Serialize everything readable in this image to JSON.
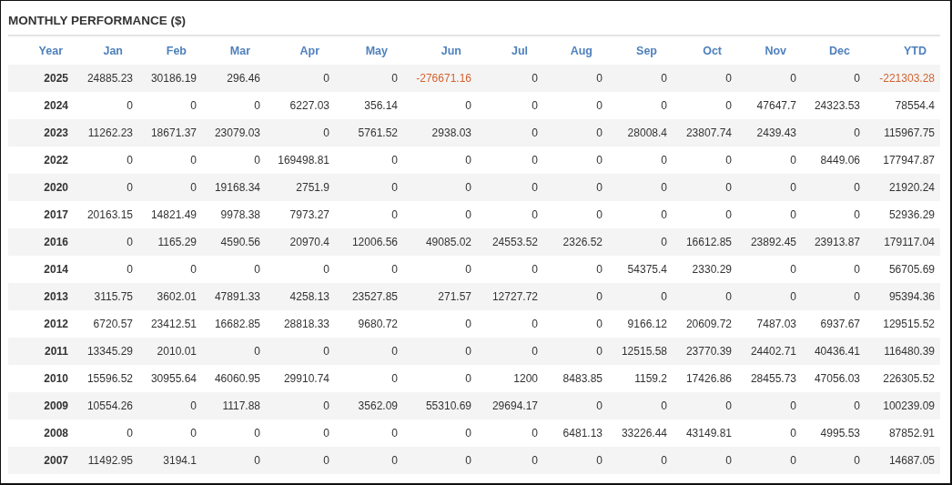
{
  "title": "MONTHLY PERFORMANCE ($)",
  "columns": [
    "Year",
    "Jan",
    "Feb",
    "Mar",
    "Apr",
    "May",
    "Jun",
    "Jul",
    "Aug",
    "Sep",
    "Oct",
    "Nov",
    "Dec",
    "YTD"
  ],
  "rows": [
    {
      "year": "2025",
      "cells": [
        {
          "text": "24885.23",
          "loss": false
        },
        {
          "text": "30186.19",
          "loss": false
        },
        {
          "text": "296.46",
          "loss": false
        },
        {
          "text": "0",
          "loss": false
        },
        {
          "text": "0",
          "loss": false
        },
        {
          "text": "-276671.16",
          "loss": true
        },
        {
          "text": "0",
          "loss": false
        },
        {
          "text": "0",
          "loss": false
        },
        {
          "text": "0",
          "loss": false
        },
        {
          "text": "0",
          "loss": false
        },
        {
          "text": "0",
          "loss": false
        },
        {
          "text": "0",
          "loss": false
        },
        {
          "text": "-221303.28",
          "loss": true
        }
      ]
    },
    {
      "year": "2024",
      "cells": [
        {
          "text": "0",
          "loss": false
        },
        {
          "text": "0",
          "loss": false
        },
        {
          "text": "0",
          "loss": false
        },
        {
          "text": "6227.03",
          "loss": false
        },
        {
          "text": "356.14",
          "loss": false
        },
        {
          "text": "0",
          "loss": false
        },
        {
          "text": "0",
          "loss": false
        },
        {
          "text": "0",
          "loss": false
        },
        {
          "text": "0",
          "loss": false
        },
        {
          "text": "0",
          "loss": false
        },
        {
          "text": "47647.7",
          "loss": false
        },
        {
          "text": "24323.53",
          "loss": false
        },
        {
          "text": "78554.4",
          "loss": false
        }
      ]
    },
    {
      "year": "2023",
      "cells": [
        {
          "text": "11262.23",
          "loss": false
        },
        {
          "text": "18671.37",
          "loss": false
        },
        {
          "text": "23079.03",
          "loss": false
        },
        {
          "text": "0",
          "loss": false
        },
        {
          "text": "5761.52",
          "loss": false
        },
        {
          "text": "2938.03",
          "loss": false
        },
        {
          "text": "0",
          "loss": false
        },
        {
          "text": "0",
          "loss": false
        },
        {
          "text": "28008.4",
          "loss": false
        },
        {
          "text": "23807.74",
          "loss": false
        },
        {
          "text": "2439.43",
          "loss": false
        },
        {
          "text": "0",
          "loss": false
        },
        {
          "text": "115967.75",
          "loss": false
        }
      ]
    },
    {
      "year": "2022",
      "cells": [
        {
          "text": "0",
          "loss": false
        },
        {
          "text": "0",
          "loss": false
        },
        {
          "text": "0",
          "loss": false
        },
        {
          "text": "169498.81",
          "loss": false
        },
        {
          "text": "0",
          "loss": false
        },
        {
          "text": "0",
          "loss": false
        },
        {
          "text": "0",
          "loss": false
        },
        {
          "text": "0",
          "loss": false
        },
        {
          "text": "0",
          "loss": false
        },
        {
          "text": "0",
          "loss": false
        },
        {
          "text": "0",
          "loss": false
        },
        {
          "text": "8449.06",
          "loss": false
        },
        {
          "text": "177947.87",
          "loss": false
        }
      ]
    },
    {
      "year": "2020",
      "cells": [
        {
          "text": "0",
          "loss": false
        },
        {
          "text": "0",
          "loss": false
        },
        {
          "text": "19168.34",
          "loss": false
        },
        {
          "text": "2751.9",
          "loss": false
        },
        {
          "text": "0",
          "loss": false
        },
        {
          "text": "0",
          "loss": false
        },
        {
          "text": "0",
          "loss": false
        },
        {
          "text": "0",
          "loss": false
        },
        {
          "text": "0",
          "loss": false
        },
        {
          "text": "0",
          "loss": false
        },
        {
          "text": "0",
          "loss": false
        },
        {
          "text": "0",
          "loss": false
        },
        {
          "text": "21920.24",
          "loss": false
        }
      ]
    },
    {
      "year": "2017",
      "cells": [
        {
          "text": "20163.15",
          "loss": false
        },
        {
          "text": "14821.49",
          "loss": false
        },
        {
          "text": "9978.38",
          "loss": false
        },
        {
          "text": "7973.27",
          "loss": false
        },
        {
          "text": "0",
          "loss": false
        },
        {
          "text": "0",
          "loss": false
        },
        {
          "text": "0",
          "loss": false
        },
        {
          "text": "0",
          "loss": false
        },
        {
          "text": "0",
          "loss": false
        },
        {
          "text": "0",
          "loss": false
        },
        {
          "text": "0",
          "loss": false
        },
        {
          "text": "0",
          "loss": false
        },
        {
          "text": "52936.29",
          "loss": false
        }
      ]
    },
    {
      "year": "2016",
      "cells": [
        {
          "text": "0",
          "loss": false
        },
        {
          "text": "1165.29",
          "loss": false
        },
        {
          "text": "4590.56",
          "loss": false
        },
        {
          "text": "20970.4",
          "loss": false
        },
        {
          "text": "12006.56",
          "loss": false
        },
        {
          "text": "49085.02",
          "loss": false
        },
        {
          "text": "24553.52",
          "loss": false
        },
        {
          "text": "2326.52",
          "loss": false
        },
        {
          "text": "0",
          "loss": false
        },
        {
          "text": "16612.85",
          "loss": false
        },
        {
          "text": "23892.45",
          "loss": false
        },
        {
          "text": "23913.87",
          "loss": false
        },
        {
          "text": "179117.04",
          "loss": false
        }
      ]
    },
    {
      "year": "2014",
      "cells": [
        {
          "text": "0",
          "loss": false
        },
        {
          "text": "0",
          "loss": false
        },
        {
          "text": "0",
          "loss": false
        },
        {
          "text": "0",
          "loss": false
        },
        {
          "text": "0",
          "loss": false
        },
        {
          "text": "0",
          "loss": false
        },
        {
          "text": "0",
          "loss": false
        },
        {
          "text": "0",
          "loss": false
        },
        {
          "text": "54375.4",
          "loss": false
        },
        {
          "text": "2330.29",
          "loss": false
        },
        {
          "text": "0",
          "loss": false
        },
        {
          "text": "0",
          "loss": false
        },
        {
          "text": "56705.69",
          "loss": false
        }
      ]
    },
    {
      "year": "2013",
      "cells": [
        {
          "text": "3115.75",
          "loss": false
        },
        {
          "text": "3602.01",
          "loss": false
        },
        {
          "text": "47891.33",
          "loss": false
        },
        {
          "text": "4258.13",
          "loss": false
        },
        {
          "text": "23527.85",
          "loss": false
        },
        {
          "text": "271.57",
          "loss": false
        },
        {
          "text": "12727.72",
          "loss": false
        },
        {
          "text": "0",
          "loss": false
        },
        {
          "text": "0",
          "loss": false
        },
        {
          "text": "0",
          "loss": false
        },
        {
          "text": "0",
          "loss": false
        },
        {
          "text": "0",
          "loss": false
        },
        {
          "text": "95394.36",
          "loss": false
        }
      ]
    },
    {
      "year": "2012",
      "cells": [
        {
          "text": "6720.57",
          "loss": false
        },
        {
          "text": "23412.51",
          "loss": false
        },
        {
          "text": "16682.85",
          "loss": false
        },
        {
          "text": "28818.33",
          "loss": false
        },
        {
          "text": "9680.72",
          "loss": false
        },
        {
          "text": "0",
          "loss": false
        },
        {
          "text": "0",
          "loss": false
        },
        {
          "text": "0",
          "loss": false
        },
        {
          "text": "9166.12",
          "loss": false
        },
        {
          "text": "20609.72",
          "loss": false
        },
        {
          "text": "7487.03",
          "loss": false
        },
        {
          "text": "6937.67",
          "loss": false
        },
        {
          "text": "129515.52",
          "loss": false
        }
      ]
    },
    {
      "year": "2011",
      "cells": [
        {
          "text": "13345.29",
          "loss": false
        },
        {
          "text": "2010.01",
          "loss": false
        },
        {
          "text": "0",
          "loss": false
        },
        {
          "text": "0",
          "loss": false
        },
        {
          "text": "0",
          "loss": false
        },
        {
          "text": "0",
          "loss": false
        },
        {
          "text": "0",
          "loss": false
        },
        {
          "text": "0",
          "loss": false
        },
        {
          "text": "12515.58",
          "loss": false
        },
        {
          "text": "23770.39",
          "loss": false
        },
        {
          "text": "24402.71",
          "loss": false
        },
        {
          "text": "40436.41",
          "loss": false
        },
        {
          "text": "116480.39",
          "loss": false
        }
      ]
    },
    {
      "year": "2010",
      "cells": [
        {
          "text": "15596.52",
          "loss": false
        },
        {
          "text": "30955.64",
          "loss": false
        },
        {
          "text": "46060.95",
          "loss": false
        },
        {
          "text": "29910.74",
          "loss": false
        },
        {
          "text": "0",
          "loss": false
        },
        {
          "text": "0",
          "loss": false
        },
        {
          "text": "1200",
          "loss": false
        },
        {
          "text": "8483.85",
          "loss": false
        },
        {
          "text": "1159.2",
          "loss": false
        },
        {
          "text": "17426.86",
          "loss": false
        },
        {
          "text": "28455.73",
          "loss": false
        },
        {
          "text": "47056.03",
          "loss": false
        },
        {
          "text": "226305.52",
          "loss": false
        }
      ]
    },
    {
      "year": "2009",
      "cells": [
        {
          "text": "10554.26",
          "loss": false
        },
        {
          "text": "0",
          "loss": false
        },
        {
          "text": "1117.88",
          "loss": false
        },
        {
          "text": "0",
          "loss": false
        },
        {
          "text": "3562.09",
          "loss": false
        },
        {
          "text": "55310.69",
          "loss": false
        },
        {
          "text": "29694.17",
          "loss": false
        },
        {
          "text": "0",
          "loss": false
        },
        {
          "text": "0",
          "loss": false
        },
        {
          "text": "0",
          "loss": false
        },
        {
          "text": "0",
          "loss": false
        },
        {
          "text": "0",
          "loss": false
        },
        {
          "text": "100239.09",
          "loss": false
        }
      ]
    },
    {
      "year": "2008",
      "cells": [
        {
          "text": "0",
          "loss": false
        },
        {
          "text": "0",
          "loss": false
        },
        {
          "text": "0",
          "loss": false
        },
        {
          "text": "0",
          "loss": false
        },
        {
          "text": "0",
          "loss": false
        },
        {
          "text": "0",
          "loss": false
        },
        {
          "text": "0",
          "loss": false
        },
        {
          "text": "6481.13",
          "loss": false
        },
        {
          "text": "33226.44",
          "loss": false
        },
        {
          "text": "43149.81",
          "loss": false
        },
        {
          "text": "0",
          "loss": false
        },
        {
          "text": "4995.53",
          "loss": false
        },
        {
          "text": "87852.91",
          "loss": false
        }
      ]
    },
    {
      "year": "2007",
      "cells": [
        {
          "text": "11492.95",
          "loss": false
        },
        {
          "text": "3194.1",
          "loss": false
        },
        {
          "text": "0",
          "loss": false
        },
        {
          "text": "0",
          "loss": false
        },
        {
          "text": "0",
          "loss": false
        },
        {
          "text": "0",
          "loss": false
        },
        {
          "text": "0",
          "loss": false
        },
        {
          "text": "0",
          "loss": false
        },
        {
          "text": "0",
          "loss": false
        },
        {
          "text": "0",
          "loss": false
        },
        {
          "text": "0",
          "loss": false
        },
        {
          "text": "0",
          "loss": false
        },
        {
          "text": "14687.05",
          "loss": false
        }
      ]
    }
  ]
}
